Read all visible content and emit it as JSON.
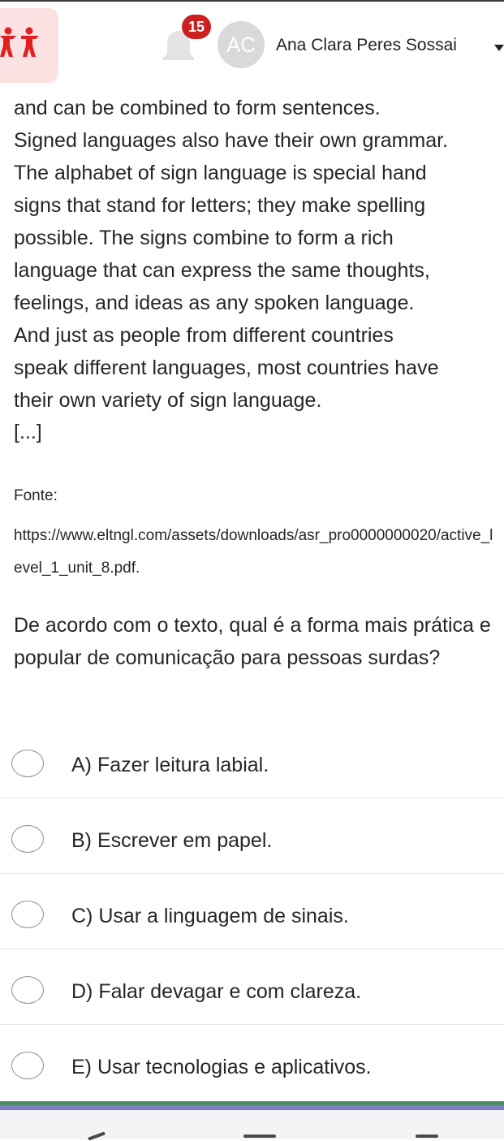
{
  "header": {
    "notification_count": "15",
    "avatar_initials": "AC",
    "user_name": "Ana Clara Peres Sossai"
  },
  "passage": {
    "lines": [
      "and can be combined to form sentences.",
      "Signed languages also have their own grammar.",
      "The alphabet of sign language is special hand",
      "signs that stand for letters; they make spelling",
      "possible. The signs combine to form a rich",
      "language that can express the same thoughts,",
      "feelings, and ideas as any spoken language.",
      "And just as people from different countries",
      "speak different languages, most countries have",
      "their own variety of sign language."
    ],
    "ellipsis": "[...]"
  },
  "source": {
    "label": "Fonte:",
    "url": "https://www.eltngl.com/assets/downloads/asr_pro0000000020/active_level_1_unit_8.pdf."
  },
  "question": "De acordo com o texto, qual é a forma mais prática e popular de comunicação para pessoas surdas?",
  "options": [
    {
      "label": "A) Fazer leitura labial."
    },
    {
      "label": "B) Escrever em papel."
    },
    {
      "label": "C) Usar a linguagem de sinais."
    },
    {
      "label": "D) Falar devagar e com clareza."
    },
    {
      "label": "E) Usar tecnologias e aplicativos."
    }
  ],
  "colors": {
    "badge": "#cc1f1f",
    "logo_bg": "#fbe1e1",
    "logo_fg": "#e02020",
    "avatar_bg": "#d9d9d9"
  },
  "icons": [
    "logo-people-icon",
    "bell-icon",
    "chevron-down-icon",
    "radio-icon"
  ]
}
